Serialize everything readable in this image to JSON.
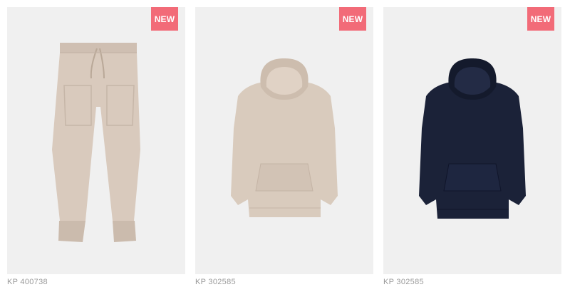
{
  "products": [
    {
      "sku": "KP 400738",
      "badge": "NEW",
      "item": "joggers",
      "color": "#d9cabd",
      "image_label": "beige joggers"
    },
    {
      "sku": "KP 302585",
      "badge": "NEW",
      "item": "hoodie",
      "color": "#d9cbbd",
      "image_label": "beige hoodie"
    },
    {
      "sku": "KP 302585",
      "badge": "NEW",
      "item": "hoodie",
      "color": "#1b2238",
      "image_label": "navy hoodie"
    }
  ],
  "colors": {
    "badge": "#f26b78",
    "card_background": "#f0f0f0",
    "sku_text": "#9a9a9a"
  }
}
